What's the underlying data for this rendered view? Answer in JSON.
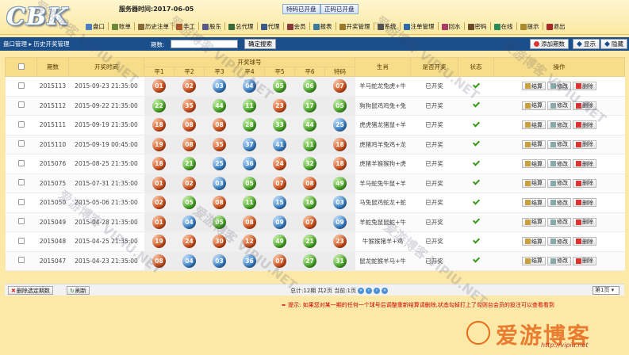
{
  "header": {
    "logo": "CBK",
    "server_time": "服务器时间:2017-06-05",
    "special_status": "特码已开盘",
    "normal_status": "正码已开盘",
    "nav": [
      {
        "label": "盘口",
        "icon": "monitor-icon",
        "color": "#4a7fc1"
      },
      {
        "label": "账单",
        "icon": "ledger-icon",
        "color": "#6a8a3a"
      },
      {
        "label": "历史注单",
        "icon": "history-icon",
        "color": "#8a6a3a"
      },
      {
        "label": "手工",
        "icon": "hand-icon",
        "color": "#b05a2a"
      },
      {
        "label": "股东",
        "icon": "shareholder-icon",
        "color": "#5a5a8a"
      },
      {
        "label": "总代理",
        "icon": "agent-icon",
        "color": "#3a6a3a"
      },
      {
        "label": "代理",
        "icon": "proxy-icon",
        "color": "#3a5a8a"
      },
      {
        "label": "会员",
        "icon": "member-icon",
        "color": "#8a3a3a"
      },
      {
        "label": "报表",
        "icon": "report-icon",
        "color": "#3a7a9a"
      },
      {
        "label": "开奖管理",
        "icon": "lottery-icon",
        "color": "#9a7a2a"
      },
      {
        "label": "系统",
        "icon": "system-icon",
        "color": "#555555"
      },
      {
        "label": "注单管理",
        "icon": "bet-icon",
        "color": "#2a6aaa"
      },
      {
        "label": "回水",
        "icon": "rebate-icon",
        "color": "#aa3a6a"
      },
      {
        "label": "密码",
        "icon": "lock-icon",
        "color": "#6a4a2a"
      },
      {
        "label": "在线",
        "icon": "online-icon",
        "color": "#2a8a5a"
      },
      {
        "label": "提示",
        "icon": "hint-icon",
        "color": "#aa8a2a"
      },
      {
        "label": "退出",
        "icon": "exit-icon",
        "color": "#aa2a2a"
      }
    ]
  },
  "toolbar": {
    "breadcrumb": "盘口管理 ▸ 历史开奖管理",
    "period_label": "期数:",
    "period_value": "",
    "query_label": "确定搜索",
    "add_label": "添加期数",
    "show_label": "显示",
    "hide_label": "隐藏"
  },
  "table": {
    "headers": {
      "period": "期数",
      "time": "开奖时间",
      "numbers_group": "开奖球号",
      "balls": [
        "平1",
        "平2",
        "平3",
        "平4",
        "平5",
        "平6",
        "特码"
      ],
      "zodiac": "生肖",
      "open": "是否开奖",
      "state": "状态",
      "ops": "操作"
    },
    "rows": [
      {
        "period": "2015113",
        "time": "2015-09-23 21:35:00",
        "balls": [
          [
            "01",
            "red"
          ],
          [
            "02",
            "red"
          ],
          [
            "03",
            "blue"
          ],
          [
            "04",
            "blue"
          ],
          [
            "05",
            "green"
          ],
          [
            "06",
            "green"
          ],
          [
            "07",
            "red"
          ]
        ],
        "zodiac": "羊马蛇龙兔虎+牛",
        "open": "已开奖"
      },
      {
        "period": "2015112",
        "time": "2015-09-22 21:35:00",
        "balls": [
          [
            "22",
            "green"
          ],
          [
            "35",
            "red"
          ],
          [
            "44",
            "green"
          ],
          [
            "11",
            "green"
          ],
          [
            "23",
            "red"
          ],
          [
            "17",
            "green"
          ],
          [
            "05",
            "green"
          ]
        ],
        "zodiac": "狗狗鼠鸡鸡兔+兔",
        "open": "已开奖"
      },
      {
        "period": "2015111",
        "time": "2015-09-19 21:35:00",
        "balls": [
          [
            "18",
            "red"
          ],
          [
            "08",
            "red"
          ],
          [
            "08",
            "red"
          ],
          [
            "28",
            "green"
          ],
          [
            "33",
            "green"
          ],
          [
            "44",
            "green"
          ],
          [
            "25",
            "blue"
          ]
        ],
        "zodiac": "虎虎猪龙猪鼠+羊",
        "open": "已开奖"
      },
      {
        "period": "2015110",
        "time": "2015-09-19 00:45:00",
        "balls": [
          [
            "19",
            "red"
          ],
          [
            "08",
            "red"
          ],
          [
            "35",
            "red"
          ],
          [
            "37",
            "blue"
          ],
          [
            "41",
            "blue"
          ],
          [
            "11",
            "green"
          ],
          [
            "18",
            "red"
          ]
        ],
        "zodiac": "虎猪鸡羊兔鸡+龙",
        "open": "已开奖"
      },
      {
        "period": "2015076",
        "time": "2015-08-25 21:35:00",
        "balls": [
          [
            "18",
            "red"
          ],
          [
            "21",
            "green"
          ],
          [
            "25",
            "blue"
          ],
          [
            "36",
            "blue"
          ],
          [
            "24",
            "red"
          ],
          [
            "32",
            "green"
          ],
          [
            "18",
            "red"
          ]
        ],
        "zodiac": "虎猪羊猴猴狗+虎",
        "open": "已开奖"
      },
      {
        "period": "2015075",
        "time": "2015-07-31 21:35:00",
        "balls": [
          [
            "01",
            "red"
          ],
          [
            "02",
            "red"
          ],
          [
            "03",
            "blue"
          ],
          [
            "05",
            "green"
          ],
          [
            "07",
            "red"
          ],
          [
            "08",
            "red"
          ],
          [
            "49",
            "green"
          ]
        ],
        "zodiac": "羊马蛇兔牛鼠+羊",
        "open": "已开奖"
      },
      {
        "period": "2015050",
        "time": "2015-05-06 21:35:00",
        "balls": [
          [
            "02",
            "red"
          ],
          [
            "05",
            "green"
          ],
          [
            "08",
            "red"
          ],
          [
            "11",
            "green"
          ],
          [
            "15",
            "blue"
          ],
          [
            "16",
            "green"
          ],
          [
            "03",
            "blue"
          ]
        ],
        "zodiac": "马兔鼠鸡蛇龙+蛇",
        "open": "已开奖"
      },
      {
        "period": "2015049",
        "time": "2015-04-28 21:35:00",
        "balls": [
          [
            "01",
            "red"
          ],
          [
            "04",
            "blue"
          ],
          [
            "05",
            "green"
          ],
          [
            "08",
            "red"
          ],
          [
            "09",
            "blue"
          ],
          [
            "07",
            "red"
          ],
          [
            "09",
            "blue"
          ]
        ],
        "zodiac": "羊蛇兔鼠鼠蛇+牛",
        "open": "已开奖"
      },
      {
        "period": "2015048",
        "time": "2015-04-25 21:35:00",
        "balls": [
          [
            "19",
            "red"
          ],
          [
            "24",
            "red"
          ],
          [
            "30",
            "red"
          ],
          [
            "12",
            "red"
          ],
          [
            "49",
            "green"
          ],
          [
            "21",
            "green"
          ],
          [
            "23",
            "red"
          ]
        ],
        "zodiac": "牛猴猴猪羊+鸡",
        "open": "已开奖"
      },
      {
        "period": "2015047",
        "time": "2015-04-23 21:35:00",
        "balls": [
          [
            "08",
            "red"
          ],
          [
            "04",
            "blue"
          ],
          [
            "03",
            "blue"
          ],
          [
            "36",
            "blue"
          ],
          [
            "07",
            "red"
          ],
          [
            "27",
            "green"
          ],
          [
            "31",
            "green"
          ]
        ],
        "zodiac": "鼠龙蛇猴羊马+牛",
        "open": "已开奖"
      }
    ],
    "ops": {
      "settle": "结算",
      "edit": "修改",
      "delete": "删除"
    }
  },
  "footer": {
    "delete_selected": "删除选定期数",
    "refresh": "刷新",
    "pager": "总计:12期 共2页 当前:1页",
    "page_select": "第1页 ▾",
    "notice": "提示: 如果您对某一期的任何一个球号后调整重新结算请删除,状态勾掉打上了勾则台会员的投注可以查看看到",
    "brand": "爱游博客",
    "brand_url": "http://vipiu.net"
  },
  "watermark": "爱游博客 VIPIU.NET"
}
